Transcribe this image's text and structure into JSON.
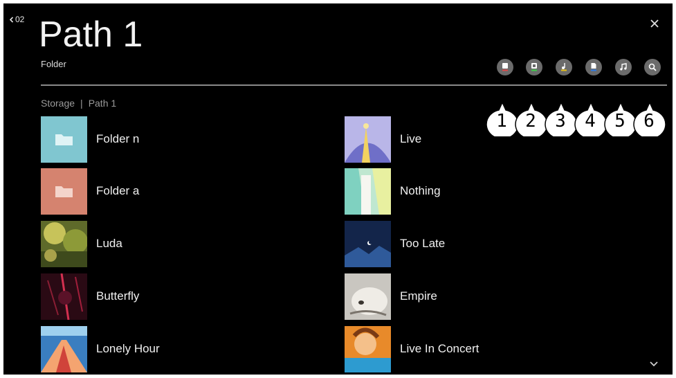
{
  "header": {
    "back_label": "02",
    "title": "Path 1",
    "subtitle": "Folder"
  },
  "breadcrumb": {
    "root": "Storage",
    "separator": "|",
    "current": "Path 1"
  },
  "toolbar": {
    "buttons": [
      {
        "icon": "storage-icon",
        "underline": "#e04a4a"
      },
      {
        "icon": "photo-video-icon",
        "underline": "#3ecf4a"
      },
      {
        "icon": "music-list-icon",
        "underline": "#e8c21a"
      },
      {
        "icon": "file-icon",
        "underline": "#2f7de8"
      },
      {
        "icon": "music-note-icon",
        "underline": null
      },
      {
        "icon": "search-icon",
        "underline": null
      }
    ],
    "callouts": [
      "1",
      "2",
      "3",
      "4",
      "5",
      "6"
    ]
  },
  "items_left": [
    {
      "label": "Folder n",
      "kind": "folder",
      "color": "#7fc4cf"
    },
    {
      "label": "Folder a",
      "kind": "folder",
      "color": "#d48272"
    },
    {
      "label": "Luda",
      "kind": "image"
    },
    {
      "label": "Butterfly",
      "kind": "image"
    },
    {
      "label": "Lonely Hour",
      "kind": "image"
    }
  ],
  "items_right": [
    {
      "label": "Live",
      "kind": "image"
    },
    {
      "label": "Nothing",
      "kind": "image"
    },
    {
      "label": "Too Late",
      "kind": "image"
    },
    {
      "label": "Empire",
      "kind": "image"
    },
    {
      "label": "Live In Concert",
      "kind": "image"
    }
  ]
}
